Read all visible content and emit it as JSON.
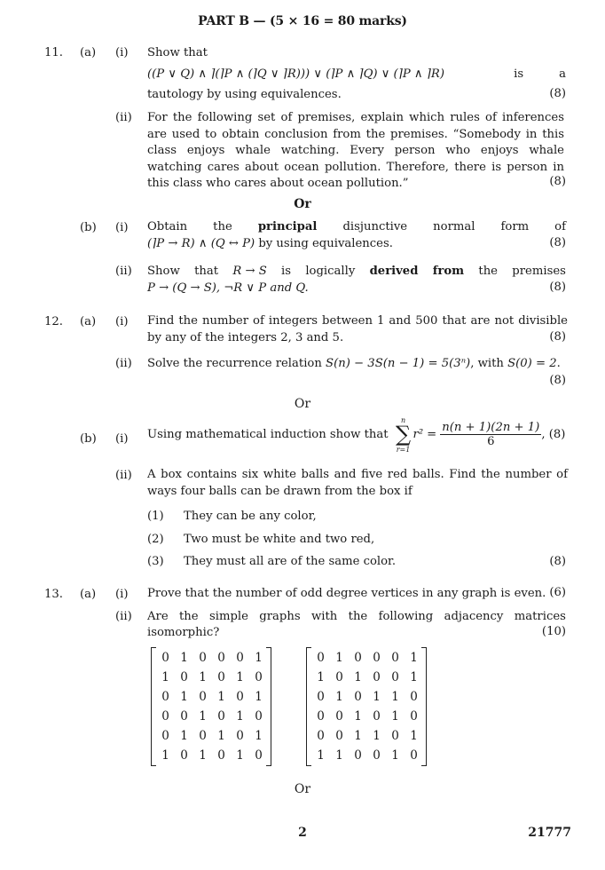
{
  "header": {
    "title": "PART B — (5 × 16 = 80 marks)"
  },
  "questions": {
    "q11": {
      "number": "11.",
      "a": {
        "label": "(a)",
        "i": {
          "label": "(i)",
          "line1": "Show that",
          "formula": "((P ∨ Q) ∧ ⌉(⌉P ∧ (⌉Q ∨ ⌉R))) ∨ (⌉P ∧ ⌉Q) ∨ (⌉P ∧ ⌉R)",
          "is": "is",
          "a": "a",
          "line3": "tautology by using equivalences.",
          "marks": "(8)"
        },
        "ii": {
          "label": "(ii)",
          "text": "For the following set of premises, explain which rules of inferences are used to obtain conclusion from the premises. “Somebody in this class enjoys whale watching. Every person who enjoys whale watching cares about ocean pollution. Therefore, there is person in this class who cares about ocean pollution.”",
          "marks": "(8)"
        }
      },
      "or": "Or",
      "b": {
        "label": "(b)",
        "i": {
          "label": "(i)",
          "words": [
            "Obtain",
            "the",
            "principal",
            "disjunctive",
            "normal",
            "form",
            "of"
          ],
          "formula": "(⌉P → R) ∧ (Q ↔ P)",
          "rest": " by using equivalences.",
          "marks": "(8)"
        },
        "ii": {
          "label": "(ii)",
          "words": [
            "Show",
            "that",
            "R → S",
            "is",
            "logically",
            "derived",
            "from",
            "the",
            "premises"
          ],
          "line2": "P → (Q → S), ¬R ∨ P and Q.",
          "marks": "(8)"
        }
      }
    },
    "q12": {
      "number": "12.",
      "a": {
        "label": "(a)",
        "i": {
          "label": "(i)",
          "text": "Find the number of integers between 1 and 500 that are not divisible by any of the integers 2, 3 and 5.",
          "marks": "(8)"
        },
        "ii": {
          "label": "(ii)",
          "text_pre": "Solve the recurrence relation ",
          "formula": "S(n) − 3S(n − 1) = 5(3ⁿ)",
          "text_mid": ", with ",
          "initial": "S(0) = 2",
          "text_end": ".",
          "marks": "(8)"
        }
      },
      "or": "Or",
      "b": {
        "label": "(b)",
        "i": {
          "label": "(i)",
          "text": "Using mathematical induction show that",
          "sigma_upper": "n",
          "sigma_lower": "r=1",
          "term": "r²",
          "equals": "=",
          "numerator": "n(n + 1)(2n + 1)",
          "denominator": "6",
          "marks": "(8)"
        },
        "ii": {
          "label": "(ii)",
          "text": "A box contains six white balls and five red balls. Find the number of ways four balls can be drawn from the box if",
          "options": [
            {
              "label": "(1)",
              "text": "They can be any color,"
            },
            {
              "label": "(2)",
              "text": "Two must be white and two red,"
            },
            {
              "label": "(3)",
              "text": "They must all are of the same color."
            }
          ],
          "marks": "(8)"
        }
      }
    },
    "q13": {
      "number": "13.",
      "a": {
        "label": "(a)",
        "i": {
          "label": "(i)",
          "text": "Prove that the number of odd degree vertices in any graph is even.",
          "marks": "(6)"
        },
        "ii": {
          "label": "(ii)",
          "line1_words": [
            "Are",
            "the",
            "simple",
            "graphs",
            "with",
            "the",
            "following",
            "adjacency",
            "matrices"
          ],
          "line2": "isomorphic?",
          "marks": "(10)",
          "matrix1": [
            [
              0,
              1,
              0,
              0,
              0,
              1
            ],
            [
              1,
              0,
              1,
              0,
              1,
              0
            ],
            [
              0,
              1,
              0,
              1,
              0,
              1
            ],
            [
              0,
              0,
              1,
              0,
              1,
              0
            ],
            [
              0,
              1,
              0,
              1,
              0,
              1
            ],
            [
              1,
              0,
              1,
              0,
              1,
              0
            ]
          ],
          "matrix2": [
            [
              0,
              1,
              0,
              0,
              0,
              1
            ],
            [
              1,
              0,
              1,
              0,
              0,
              1
            ],
            [
              0,
              1,
              0,
              1,
              1,
              0
            ],
            [
              0,
              0,
              1,
              0,
              1,
              0
            ],
            [
              0,
              0,
              1,
              1,
              0,
              1
            ],
            [
              1,
              1,
              0,
              0,
              1,
              0
            ]
          ]
        }
      },
      "or": "Or"
    }
  },
  "footer": {
    "page_number": "2",
    "paper_code": "21777"
  }
}
